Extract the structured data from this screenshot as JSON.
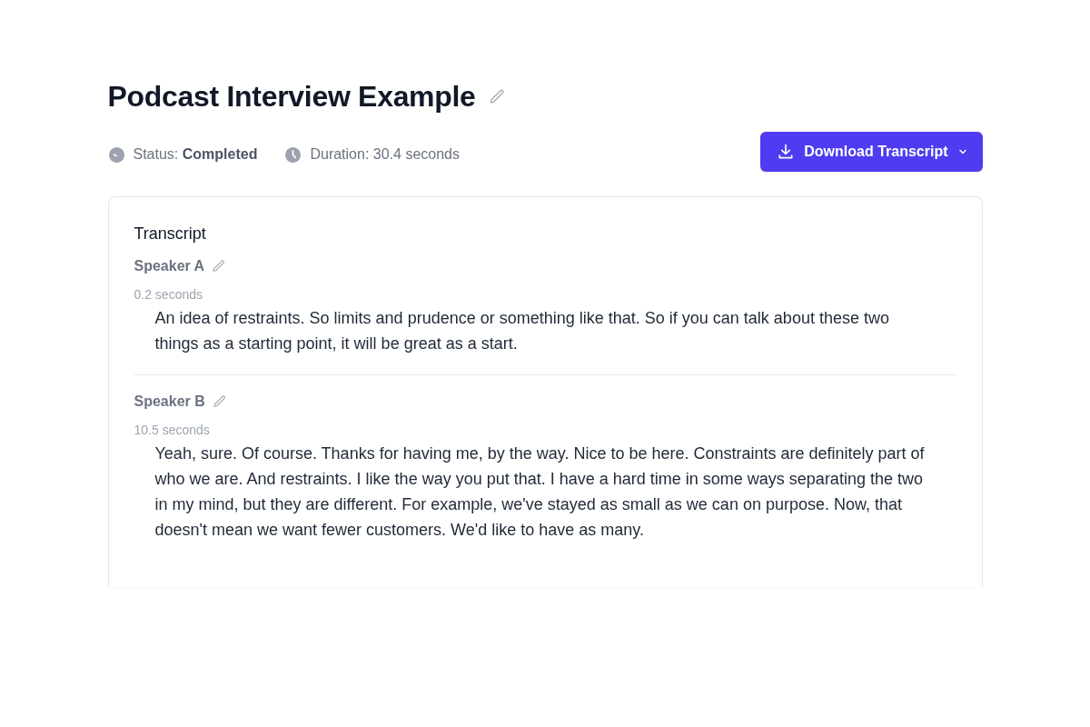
{
  "title": "Podcast Interview Example",
  "meta": [
    {
      "kind": "status",
      "text": "Status: **Completed**"
    },
    {
      "kind": "duration",
      "text": "Duration: 30.4 seconds"
    }
  ],
  "download_button": {
    "label": "Download Transcript"
  },
  "transcript": {
    "heading": "Transcript",
    "segments": [
      {
        "speaker": "Speaker A",
        "time": "0.2 seconds",
        "text": "An idea of restraints. So limits and prudence or something like that. So if you can talk about these two things as a starting point, it will be great as a start."
      },
      {
        "speaker": "Speaker B",
        "time": "10.5 seconds",
        "text": "Yeah, sure. Of course. Thanks for having me, by the way. Nice to be here. Constraints are definitely part of who we are. And restraints. I like the way you put that. I have a hard time in some ways separating the two in my mind, but they are different. For example, we've stayed as small as we can on purpose. Now, that doesn't mean we want fewer customers. We'd like to have as many."
      }
    ]
  }
}
